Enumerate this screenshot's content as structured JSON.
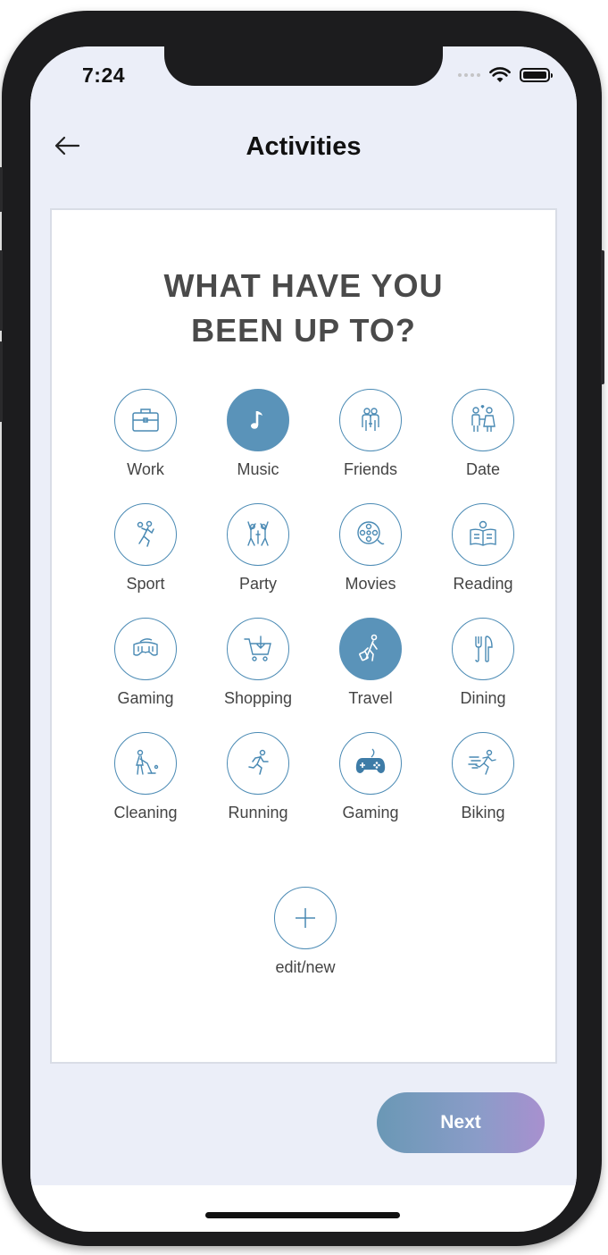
{
  "status_bar": {
    "time": "7:24"
  },
  "header": {
    "title": "Activities"
  },
  "prompt": {
    "line1": "WHAT HAVE YOU",
    "line2": "BEEN UP TO?"
  },
  "activities": [
    {
      "label": "Work",
      "icon": "briefcase-icon",
      "selected": false
    },
    {
      "label": "Music",
      "icon": "music-note-icon",
      "selected": true
    },
    {
      "label": "Friends",
      "icon": "friends-icon",
      "selected": false
    },
    {
      "label": "Date",
      "icon": "date-couple-icon",
      "selected": false
    },
    {
      "label": "Sport",
      "icon": "handball-icon",
      "selected": false
    },
    {
      "label": "Party",
      "icon": "party-dancers-icon",
      "selected": false
    },
    {
      "label": "Movies",
      "icon": "film-reel-icon",
      "selected": false
    },
    {
      "label": "Reading",
      "icon": "reading-icon",
      "selected": false
    },
    {
      "label": "Gaming",
      "icon": "vr-headset-icon",
      "selected": false
    },
    {
      "label": "Shopping",
      "icon": "shopping-cart-icon",
      "selected": false
    },
    {
      "label": "Travel",
      "icon": "traveler-luggage-icon",
      "selected": true
    },
    {
      "label": "Dining",
      "icon": "fork-knife-icon",
      "selected": false
    },
    {
      "label": "Cleaning",
      "icon": "cleaning-broom-icon",
      "selected": false
    },
    {
      "label": "Running",
      "icon": "runner-icon",
      "selected": false
    },
    {
      "label": "Gaming",
      "icon": "gamepad-icon",
      "selected": false
    },
    {
      "label": "Biking",
      "icon": "speed-runner-icon",
      "selected": false
    }
  ],
  "add_new": {
    "label": "edit/new",
    "icon": "plus-icon"
  },
  "next_button": {
    "label": "Next"
  },
  "colors": {
    "accent": "#5a93b9",
    "background": "#ebeef8",
    "next_gradient_start": "#6a98b5",
    "next_gradient_end": "#a890cf"
  }
}
